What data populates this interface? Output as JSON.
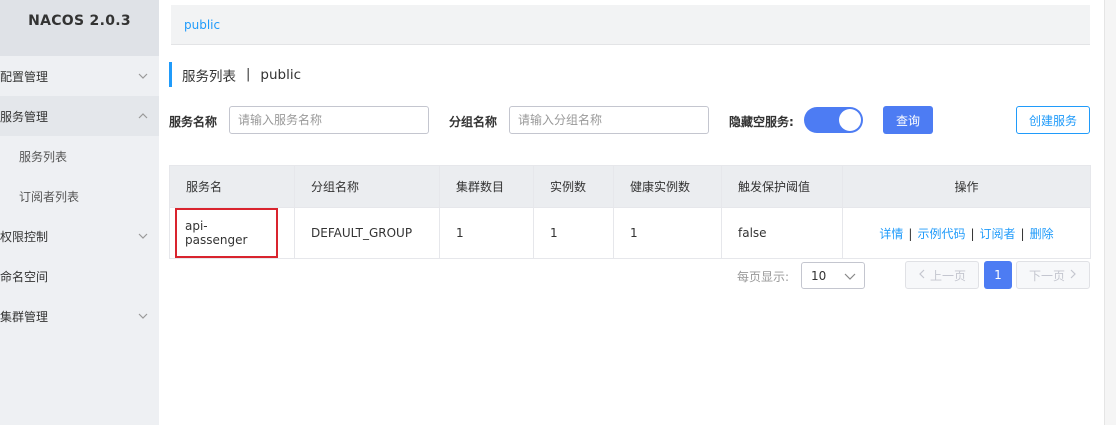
{
  "app": {
    "title": "NACOS 2.0.3"
  },
  "sidebar": {
    "items": [
      {
        "label": "配置管理",
        "expanded": false
      },
      {
        "label": "服务管理",
        "expanded": true
      },
      {
        "label": "服务列表"
      },
      {
        "label": "订阅者列表"
      },
      {
        "label": "权限控制",
        "expanded": false
      },
      {
        "label": "命名空间"
      },
      {
        "label": "集群管理",
        "expanded": false
      }
    ]
  },
  "namespace_bar": {
    "current": "public"
  },
  "page": {
    "title": "服务列表",
    "separator": "|",
    "namespace": "public"
  },
  "filters": {
    "service_name_label": "服务名称",
    "service_name_placeholder": "请输入服务名称",
    "group_name_label": "分组名称",
    "group_name_placeholder": "请输入分组名称",
    "hide_empty_label": "隐藏空服务:",
    "hide_empty_on": true,
    "query_button": "查询",
    "create_button": "创建服务"
  },
  "table": {
    "columns": [
      "服务名",
      "分组名称",
      "集群数目",
      "实例数",
      "健康实例数",
      "触发保护阈值",
      "操作"
    ],
    "rows": [
      {
        "service_name": "api-passenger",
        "group_name": "DEFAULT_GROUP",
        "cluster_count": "1",
        "instance_count": "1",
        "healthy_instance_count": "1",
        "protect_threshold_triggered": "false",
        "actions": [
          "详情",
          "示例代码",
          "订阅者",
          "删除"
        ]
      }
    ]
  },
  "pagination": {
    "page_size_label": "每页显示:",
    "page_size": "10",
    "prev": "上一页",
    "current_page": "1",
    "next": "下一页"
  },
  "colors": {
    "accent": "#209bfa",
    "primary": "#4d7cf3",
    "highlight_border": "#d9242e"
  }
}
